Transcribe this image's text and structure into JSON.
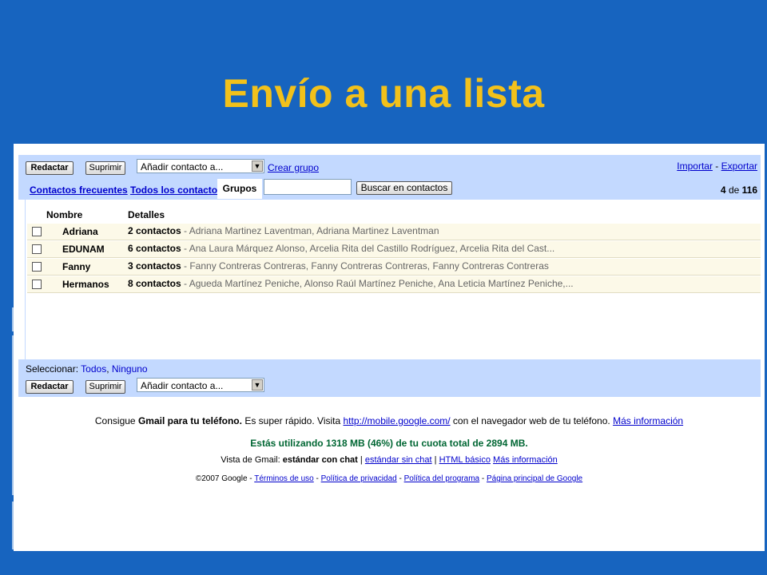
{
  "slide_title": "Envío a una lista",
  "toolbar": {
    "compose_label": "Redactar",
    "delete_label": "Suprimir",
    "add_to_select": "Añadir contacto a...",
    "create_group_link": "Crear grupo",
    "import_link": "Importar",
    "separator": "-",
    "export_link": "Exportar"
  },
  "tabs": {
    "frequent": "Contactos frecuentes",
    "all": "Todos los contactos",
    "groups": "Grupos"
  },
  "search": {
    "value": "",
    "button_label": "Buscar en contactos"
  },
  "pagination": {
    "current": "4",
    "of_label": "de",
    "total": "116"
  },
  "table": {
    "headers": [
      "Nombre",
      "Detalles"
    ],
    "rows": [
      {
        "name": "Adriana",
        "count": "2 contactos",
        "members": " - Adriana Martinez Laventman, Adriana Martinez Laventman"
      },
      {
        "name": "EDUNAM",
        "count": "6 contactos",
        "members": " - Ana Laura Márquez Alonso, Arcelia Rita del Castillo Rodríguez, Arcelia Rita del Cast..."
      },
      {
        "name": "Fanny",
        "count": "3 contactos",
        "members": " - Fanny Contreras Contreras, Fanny Contreras Contreras, Fanny Contreras Contreras"
      },
      {
        "name": "Hermanos",
        "count": "8 contactos",
        "members": " - Agueda Martínez Peniche, Alonso Raúl Martínez Peniche, Ana Leticia Martínez Peniche,..."
      }
    ]
  },
  "select_bar": {
    "label": "Seleccionar:",
    "all_link": "Todos",
    "comma": ",",
    "none_link": "Ninguno"
  },
  "footer": {
    "promo_pre": "Consigue",
    "promo_bold": "Gmail para tu teléfono.",
    "promo_mid": "Es super rápido. Visita",
    "promo_url": "http://mobile.google.com/",
    "promo_post": "con el navegador web de tu teléfono.",
    "promo_more": "Más información",
    "quota": "Estás utilizando 1318 MB (46%) de tu cuota total de 2894 MB.",
    "view_label": "Vista de Gmail:",
    "view_current": "estándar con chat",
    "view_sep": "|",
    "view_no_chat": "estándar sin chat",
    "view_html": "HTML básico",
    "view_more": "Más información",
    "copyright": "©2007 Google",
    "dash": "-",
    "terms": "Términos de uso",
    "privacy": "Política de privacidad",
    "program": "Política del programa",
    "homepage": "Página principal de Google"
  }
}
